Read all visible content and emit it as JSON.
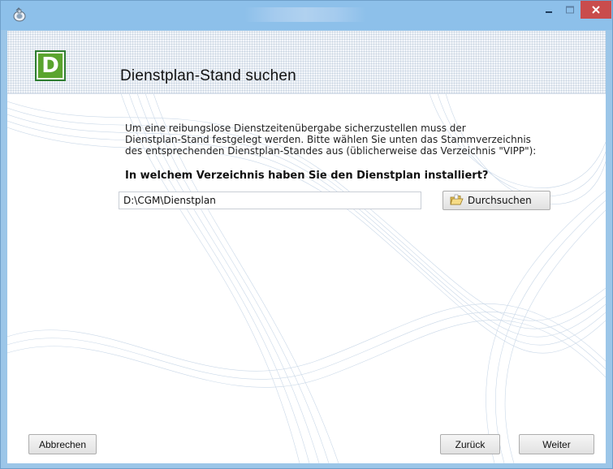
{
  "window": {
    "title": "",
    "colors": {
      "frame": "#9cc6e8",
      "close": "#c94c4c",
      "logo_green": "#5aa42e"
    }
  },
  "header": {
    "logo_letter": "D",
    "title": "Dienstplan-Stand suchen"
  },
  "content": {
    "intro": "Um eine reibungslose Dienstzeitenübergabe sicherzustellen muss der\nDienstplan-Stand festgelegt werden. Bitte wählen Sie unten das Stammverzeichnis\ndes entsprechenden Dienstplan-Standes aus (üblicherweise das Verzeichnis \"VIPP\"):",
    "question": "In welchem Verzeichnis haben Sie den Dienstplan installiert?",
    "path_value": "D:\\CGM\\Dienstplan",
    "browse_label": "Durchsuchen"
  },
  "footer": {
    "cancel_label": "Abbrechen",
    "back_label": "Zurück",
    "next_label": "Weiter"
  },
  "icons": {
    "app": "app-icon",
    "minimize": "minimize-icon",
    "maximize": "maximize-icon",
    "close": "close-icon",
    "browse": "folder-icon"
  }
}
